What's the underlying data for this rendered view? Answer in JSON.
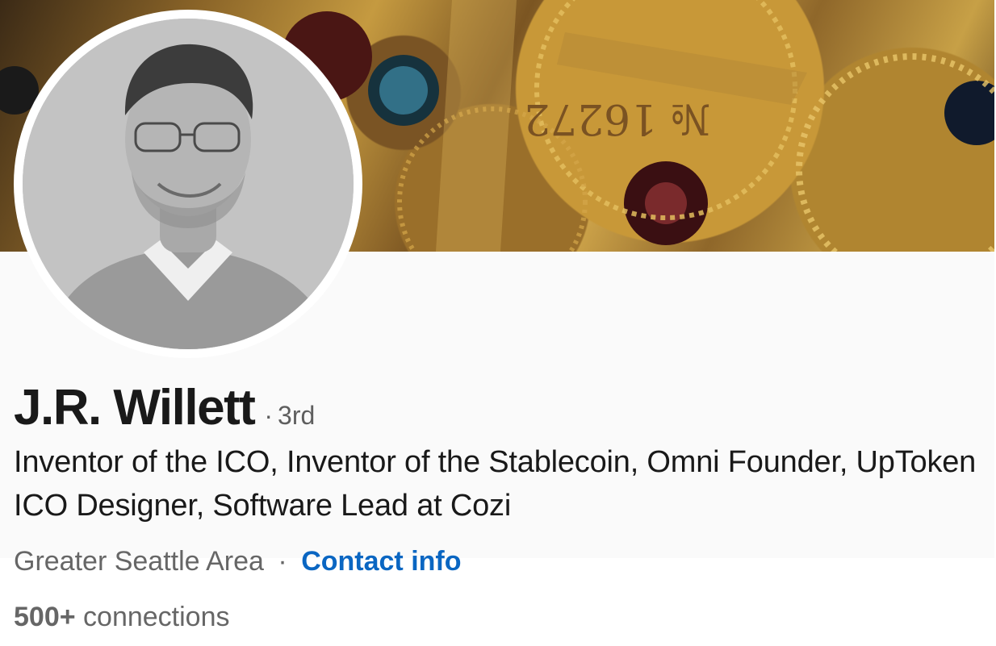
{
  "profile": {
    "name": "J.R. Willett",
    "degree_separator": "·",
    "degree": "3rd",
    "headline": "Inventor of the ICO, Inventor of the Stablecoin, Omni Founder, UpToken ICO Designer, Software Lead at Cozi",
    "location": "Greater Seattle Area",
    "location_separator": "·",
    "contact_link": "Contact info",
    "connections_count": "500+",
    "connections_label": "connections"
  },
  "cover": {
    "engraving": "№ 16272",
    "description_icon": "brass-clockwork-cover-image"
  },
  "avatar": {
    "icon": "profile-photo-avatar"
  },
  "colors": {
    "link": "#0a66c2",
    "name": "#191919",
    "secondary_text": "#666666",
    "panel_background": "#fafafa"
  }
}
